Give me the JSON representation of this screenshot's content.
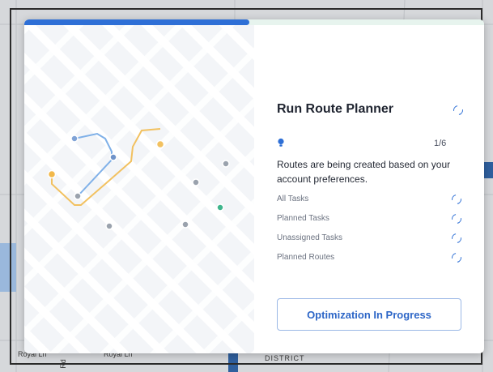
{
  "map": {
    "labels": [
      "Royal Ln",
      "Royal Ln",
      "Rd",
      "DISTRICT"
    ]
  },
  "modal": {
    "progress_fraction": 0.49,
    "title": "Run Route Planner",
    "counter": "1/6",
    "message": "Routes are being created based on your account preferences.",
    "tasks": [
      {
        "label": "All Tasks"
      },
      {
        "label": "Planned Tasks"
      },
      {
        "label": "Unassigned Tasks"
      },
      {
        "label": "Planned Routes"
      }
    ],
    "button_label": "Optimization In Progress"
  },
  "colors": {
    "accent": "#2e6fd6",
    "route_blue": "#7fb0e8",
    "route_orange": "#f2c160",
    "stop_grey": "#9aa2ad",
    "stop_green": "#3fb58c"
  }
}
